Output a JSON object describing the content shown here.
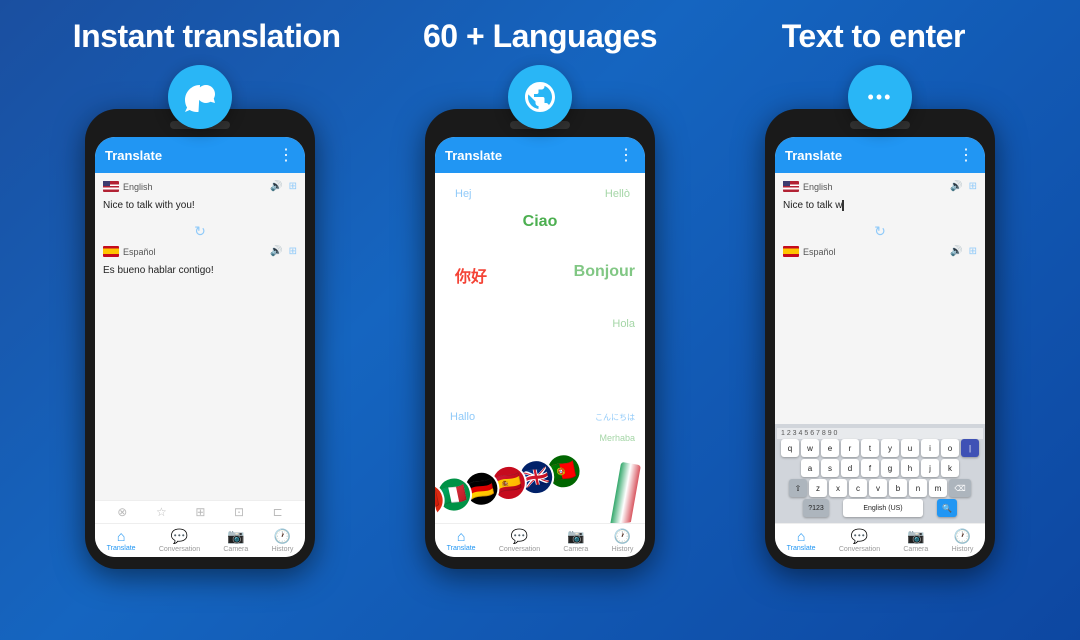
{
  "header": {
    "col1": "Instant translation",
    "col2": "60 + Languages",
    "col3": "Text to enter"
  },
  "phone1": {
    "appbar_title": "Translate",
    "lang1": "English",
    "text1": "Nice to talk with you!",
    "lang2": "Español",
    "text2": "Es bueno hablar contigo!",
    "nav_items": [
      "Translate",
      "Conversation",
      "Camera",
      "History"
    ]
  },
  "phone2": {
    "appbar_title": "Translate",
    "words": [
      "Hej",
      "Hellò",
      "Ciao",
      "你好",
      "Bonjour",
      "Hola",
      "Hallo",
      "こんにちは",
      "Merhaba"
    ],
    "nav_items": [
      "Translate",
      "Conversation",
      "Camera",
      "History"
    ]
  },
  "phone3": {
    "appbar_title": "Translate",
    "lang1": "English",
    "text1": "Nice to talk w",
    "lang2": "Español",
    "keyboard_rows": [
      [
        "1",
        "2",
        "3",
        "4",
        "5",
        "6",
        "7",
        "8",
        "9",
        "0"
      ],
      [
        "q",
        "w",
        "e",
        "r",
        "t",
        "y",
        "u",
        "i",
        "o"
      ],
      [
        "a",
        "s",
        "d",
        "f",
        "g",
        "h",
        "j",
        "k"
      ],
      [
        "z",
        "x",
        "c",
        "v",
        "b",
        "n",
        "m"
      ],
      [
        "?123",
        "",
        "English (US)",
        ""
      ]
    ],
    "nav_items": [
      "Translate",
      "Conversation",
      "Camera",
      "History"
    ]
  },
  "icons": {
    "refresh": "↻",
    "globe": "🌐",
    "dots": "•••",
    "volume": "🔊",
    "copy": "⊞",
    "arrow_down": "↓",
    "translate_icon": "⊙",
    "star": "☆",
    "share": "⊏",
    "camera": "⊡",
    "expand": "⊠"
  },
  "colors": {
    "blue": "#2196f3",
    "lightBlue": "#29b6f6",
    "green": "#4caf50",
    "bg": "#1565c0"
  }
}
